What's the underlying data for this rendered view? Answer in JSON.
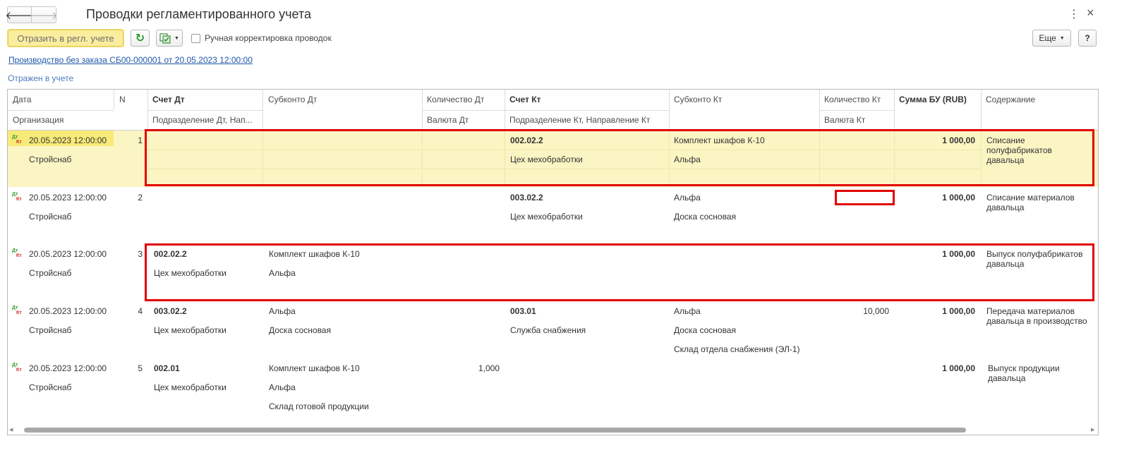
{
  "window": {
    "title": "Проводки регламентированного учета",
    "menu_glyph": "⋮",
    "close_glyph": "×"
  },
  "nav": {
    "back_glyph": "🡐",
    "forward_glyph": "🡒"
  },
  "toolbar": {
    "reflect_label": "Отразить в регл. учете",
    "refresh_glyph": "↻",
    "manual_correction_label": "Ручная корректировка проводок",
    "more_label": "Еще",
    "help_label": "?"
  },
  "document_link": "Производство без заказа СБ00-000001 от 20.05.2023 12:00:00",
  "status_text": "Отражен в учете",
  "table": {
    "headers_top": {
      "date": "Дата",
      "n": "N",
      "account_dt": "Счет Дт",
      "subconto_dt": "Субконто Дт",
      "qty_dt": "Количество Дт",
      "account_kt": "Счет Кт",
      "subconto_kt": "Субконто Кт",
      "qty_kt": "Количество Кт",
      "sum": "Сумма БУ (RUB)",
      "content": "Содержание"
    },
    "headers_bottom": {
      "org": "Организация",
      "dept_dt": "Подразделение Дт, Нап...",
      "currency_dt": "Валюта Дт",
      "dept_kt": "Подразделение Кт, Направление Кт",
      "currency_kt": "Валюта Кт"
    },
    "dtkt_icon": {
      "dt": "Дт",
      "kt": "Кт"
    },
    "rows": [
      {
        "date": "20.05.2023 12:00:00",
        "n": "1",
        "org": "Стройснаб",
        "account_dt": "",
        "dept_dt": "",
        "subconto_dt": [
          "",
          "",
          ""
        ],
        "qty_dt": "",
        "account_kt": "002.02.2",
        "dept_kt": "Цех мехобработки",
        "subconto_kt": [
          "Комплект шкафов К-10",
          "Альфа",
          ""
        ],
        "qty_kt": "",
        "sum": "1 000,00",
        "content": "Списание полуфабрикатов давальца"
      },
      {
        "date": "20.05.2023 12:00:00",
        "n": "2",
        "org": "Стройснаб",
        "account_dt": "",
        "dept_dt": "",
        "subconto_dt": [
          "",
          "",
          ""
        ],
        "qty_dt": "",
        "account_kt": "003.02.2",
        "dept_kt": "Цех мехобработки",
        "subconto_kt": [
          "Альфа",
          "Доска сосновая",
          ""
        ],
        "qty_kt": "",
        "sum": "1 000,00",
        "content": "Списание материалов давальца"
      },
      {
        "date": "20.05.2023 12:00:00",
        "n": "3",
        "org": "Стройснаб",
        "account_dt": "002.02.2",
        "dept_dt": "Цех мехобработки",
        "subconto_dt": [
          "Комплект шкафов К-10",
          "Альфа",
          ""
        ],
        "qty_dt": "",
        "account_kt": "",
        "dept_kt": "",
        "subconto_kt": [
          "",
          "",
          ""
        ],
        "qty_kt": "",
        "sum": "1 000,00",
        "content": "Выпуск полуфабрикатов давальца"
      },
      {
        "date": "20.05.2023 12:00:00",
        "n": "4",
        "org": "Стройснаб",
        "account_dt": "003.02.2",
        "dept_dt": "Цех мехобработки",
        "subconto_dt": [
          "Альфа",
          "Доска сосновая",
          ""
        ],
        "qty_dt": "",
        "account_kt": "003.01",
        "dept_kt": "Служба снабжения",
        "subconto_kt": [
          "Альфа",
          "Доска сосновая",
          "Склад отдела снабжения (ЭЛ-1)"
        ],
        "qty_kt": "10,000",
        "sum": "1 000,00",
        "content": "Передача материалов давальца в производство"
      },
      {
        "date": "20.05.2023 12:00:00",
        "n": "5",
        "org": "Стройснаб",
        "account_dt": "002.01",
        "dept_dt": "Цех мехобработки",
        "subconto_dt": [
          "Комплект шкафов К-10",
          "Альфа",
          "Склад готовой продукции"
        ],
        "qty_dt": "1,000",
        "account_kt": "",
        "dept_kt": "",
        "subconto_kt": [
          "",
          "",
          ""
        ],
        "qty_kt": "",
        "sum": "1 000,00",
        "content": "Выпуск продукции давальца"
      }
    ]
  },
  "colors": {
    "selected_row": "#fbf5c4",
    "highlight_red": "#e10000",
    "link_blue": "#1f56a8",
    "yellow_button": "#fbed9e"
  }
}
